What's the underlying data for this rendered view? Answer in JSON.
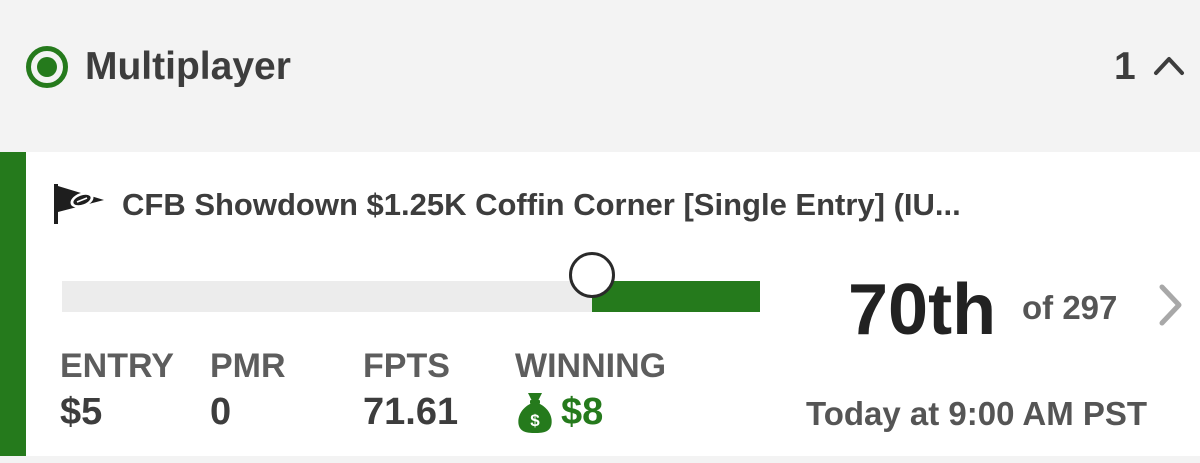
{
  "section": {
    "icon": "radio-selected-icon",
    "title": "Multiplayer",
    "count": "1",
    "toggle_icon": "chevron-up-icon"
  },
  "contest": {
    "icon": "football-pennant-icon",
    "title": "CFB Showdown $1.25K Coffin Corner [Single Entry] (IU...",
    "progress_fraction": 0.76,
    "rank": "70th",
    "rank_of": "of 297",
    "detail_icon": "chevron-right-icon",
    "stats": {
      "entry": {
        "label": "ENTRY",
        "value": "$5"
      },
      "pmr": {
        "label": "PMR",
        "value": "0"
      },
      "fpts": {
        "label": "FPTS",
        "value": "71.61"
      },
      "winning": {
        "label": "WINNING",
        "value": "$8",
        "icon": "money-bag-icon"
      }
    },
    "start_time": "Today at 9:00 AM PST"
  },
  "colors": {
    "accent": "#257a1c",
    "text_dark": "#3d3d3d",
    "text_muted": "#5d5d5d",
    "background": "#f3f3f3",
    "card": "#ffffff",
    "track": "#ececec"
  }
}
